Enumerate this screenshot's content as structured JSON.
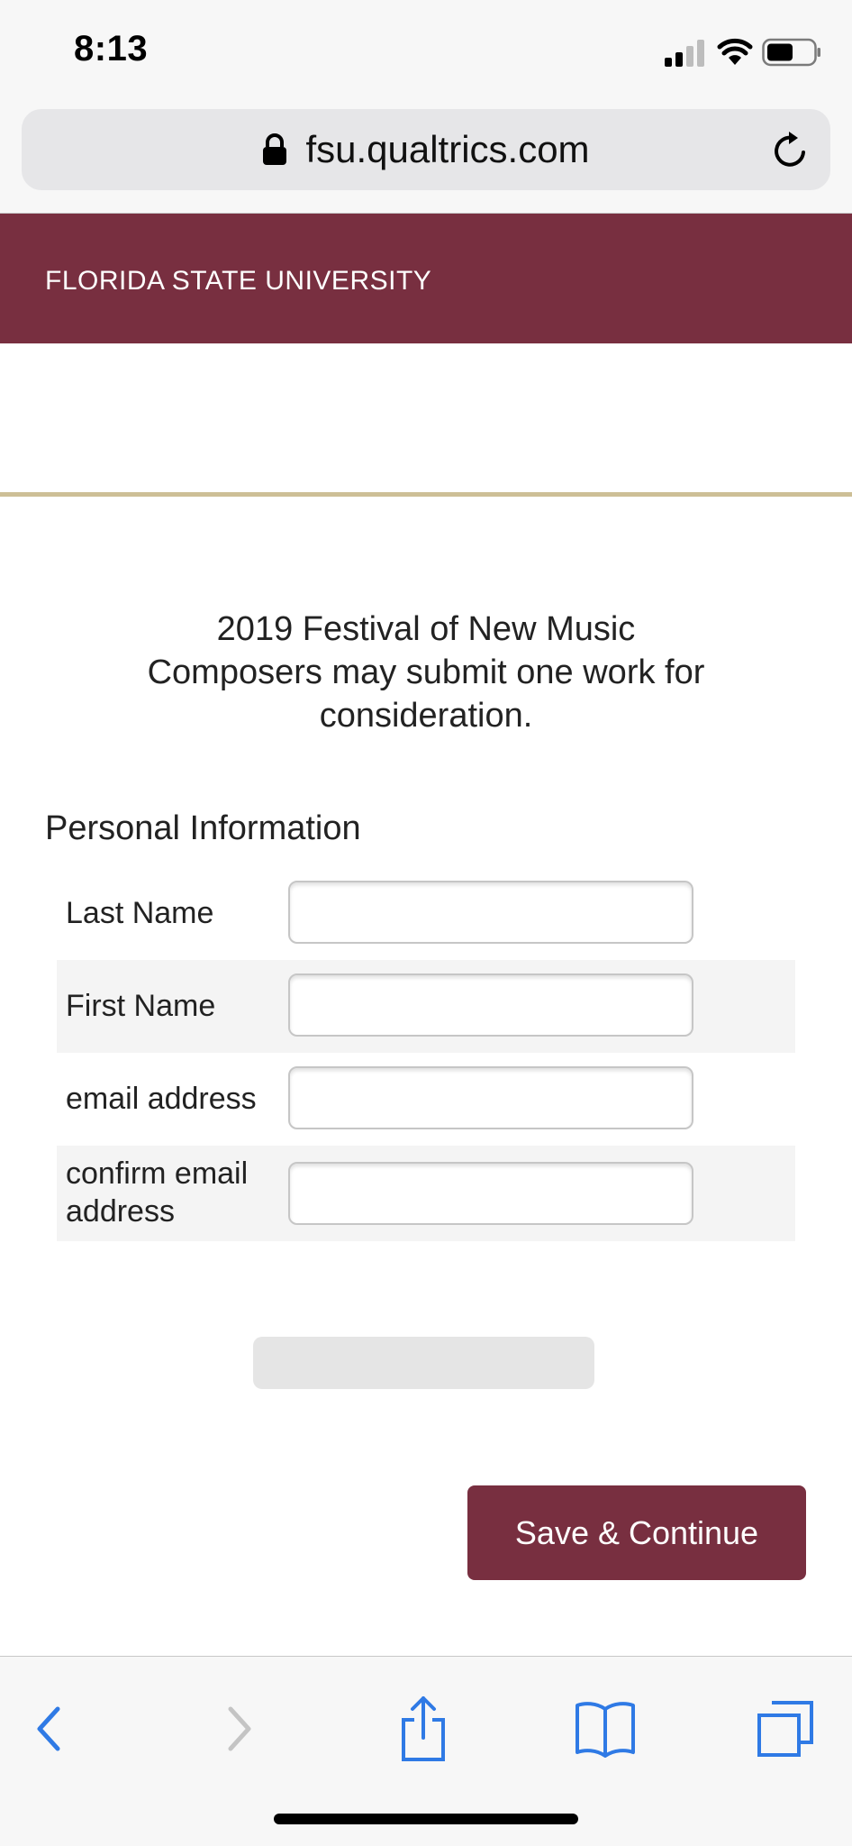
{
  "status_bar": {
    "time": "8:13"
  },
  "browser": {
    "url": "fsu.qualtrics.com"
  },
  "header": {
    "university": "FLORIDA STATE UNIVERSITY"
  },
  "survey": {
    "intro_line1": "2019 Festival of New Music",
    "intro_line2": "Composers may submit one work for",
    "intro_line3": "consideration.",
    "section_title": "Personal Information",
    "fields": [
      {
        "label": "Last Name",
        "value": ""
      },
      {
        "label": "First Name",
        "value": ""
      },
      {
        "label": "email address",
        "value": ""
      },
      {
        "label_line1": "confirm email",
        "label_line2": "address",
        "value": ""
      }
    ],
    "progress": 0,
    "save_label": "Save & Continue"
  },
  "colors": {
    "brand": "#782f40",
    "gold": "#cdbf96",
    "ios_blue": "#2f7ae5"
  },
  "toolbar_icons": [
    "back-icon",
    "forward-icon",
    "share-icon",
    "bookmarks-icon",
    "tabs-icon"
  ]
}
